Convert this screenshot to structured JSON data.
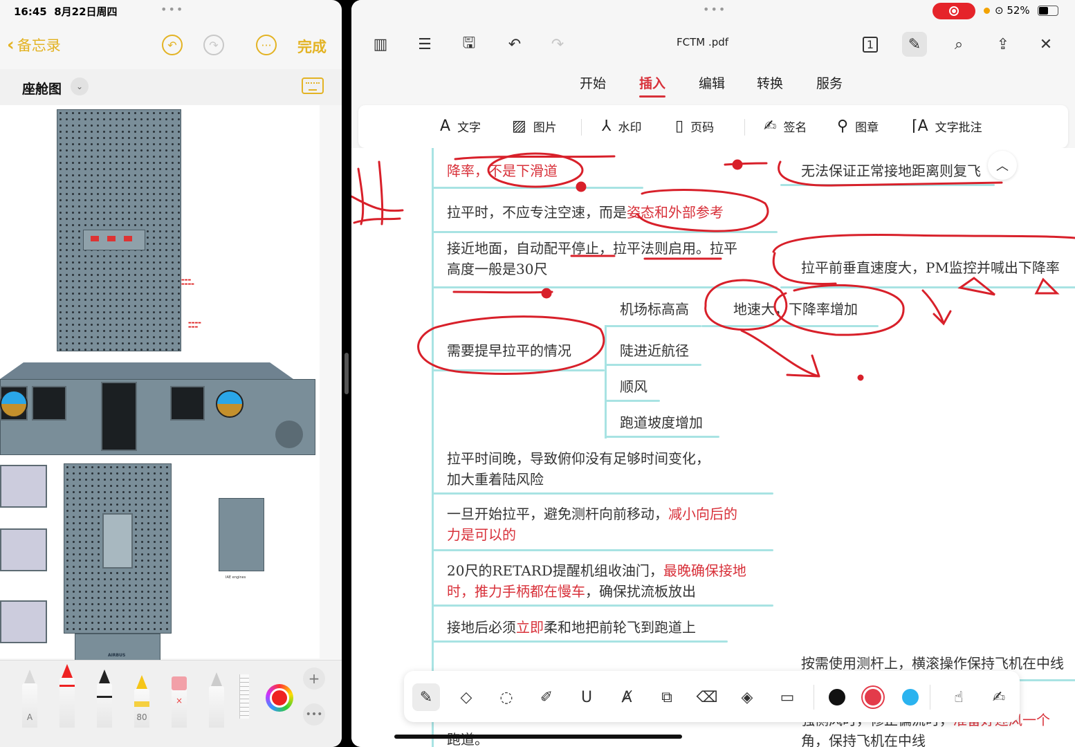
{
  "left": {
    "status_time": "16:45",
    "status_date": "8月22日周四",
    "nav": {
      "back_label": "备忘录",
      "done_label": "完成"
    },
    "note_title": "座舱图",
    "image_caption_engines": "IAE engines",
    "image_logo": "AIRBUS",
    "tools": {
      "pencil_letter": "A",
      "marker_number": "80"
    },
    "colors": {
      "accent": "#e3b324",
      "selected_ink": "#e22222"
    }
  },
  "right": {
    "status": {
      "battery": "52%"
    },
    "toolbar": {
      "filename": "FCTM .pdf"
    },
    "tabs": [
      {
        "label": "开始"
      },
      {
        "label": "插入"
      },
      {
        "label": "编辑"
      },
      {
        "label": "转换"
      },
      {
        "label": "服务"
      }
    ],
    "active_tab": "插入",
    "insert_tools": [
      {
        "label": "文字",
        "icon": "text-icon"
      },
      {
        "label": "图片",
        "icon": "image-icon"
      },
      {
        "label": "水印",
        "icon": "watermark-icon"
      },
      {
        "label": "页码",
        "icon": "page-number-icon"
      },
      {
        "label": "签名",
        "icon": "signature-icon"
      },
      {
        "label": "图章",
        "icon": "stamp-icon"
      },
      {
        "label": "文字批注",
        "icon": "text-annotation-icon"
      }
    ],
    "mindmap": {
      "n1a": "降率，",
      "n1b": "不是下滑道",
      "n1_right": "无法保证正常接地距离则复飞",
      "n2a": "拉平时，不应专注空速，而是",
      "n2b": "姿态和外部参考",
      "n3_line1": "接近地面，自动配平停止，拉平法则启用。拉平",
      "n3_line2": "高度一般是30尺",
      "n3_right": "拉平前垂直速度大，PM监控并喊出下降率",
      "n4_center": "需要提早拉平的情况",
      "n4_items": [
        "机场标高高",
        "陡进近航径",
        "顺风",
        "跑道坡度增加"
      ],
      "n4_sub": "地速大，下降率增加",
      "n5_line1": "拉平时间晚，导致俯仰没有足够时间变化，",
      "n5_line2": "加大重着陆风险",
      "n6_line1a": "一旦开始拉平，避免测杆向前移动，",
      "n6_line1b": "减小向后的",
      "n6_line2": "力是可以的",
      "n7_line1a": "20尺的RETARD提醒机组收油门，",
      "n7_line1b": "最晚确保接地",
      "n7_line2a": "时，推力手柄都在慢车",
      "n7_line2b": "，确保扰流板放出",
      "n8a": "接地后必须",
      "n8b": "立即",
      "n8c": "柔和地把前轮飞到跑道上",
      "n9_right": "按需使用测杆上，横滚操作保持飞机在中线",
      "bottom_left": "跑道。",
      "bottom_right_a": "强侧风时，修正偏流时，",
      "bottom_right_b": "准备好迎风一个",
      "bottom_right_c": "角，保持飞机在中线"
    },
    "pen_colors": [
      "#111111",
      "#e33b4a",
      "#2bb3ef"
    ],
    "colors": {
      "accent": "#d8313a",
      "ink": "#d8202a",
      "branch_line": "#a8e3e3"
    }
  }
}
